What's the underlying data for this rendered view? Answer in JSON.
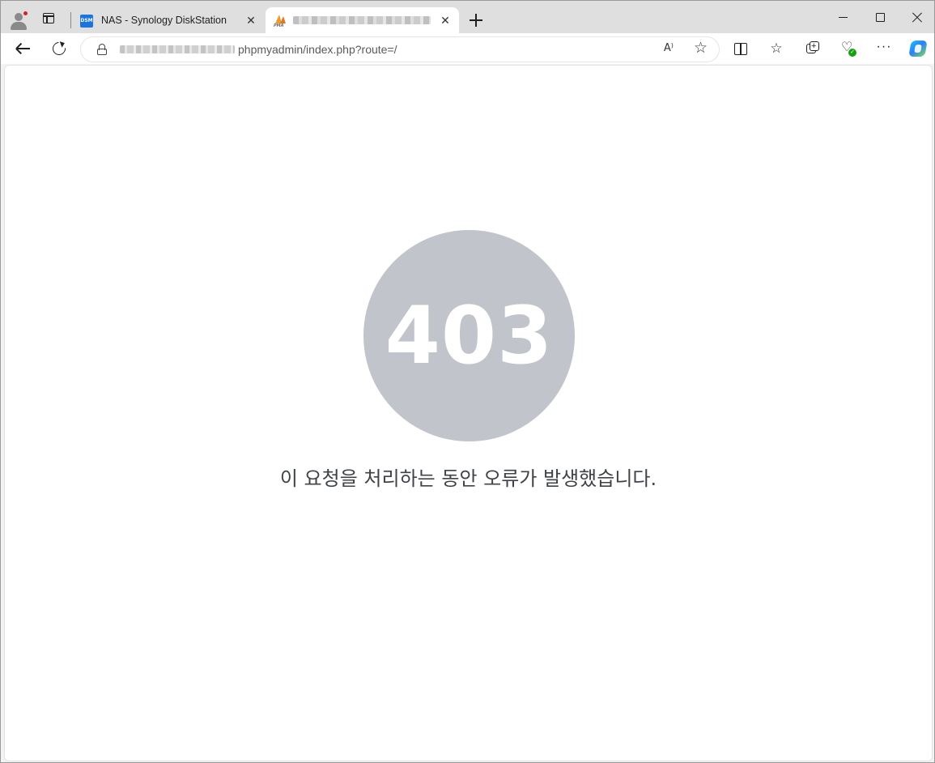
{
  "browser": {
    "tabs": [
      {
        "title": "NAS - Synology DiskStation",
        "favicon_label": "DSM",
        "active": false
      },
      {
        "title": "",
        "favicon_label": "PMA",
        "active": true,
        "title_blurred": true
      }
    ],
    "address_bar": {
      "url_visible_part": "phpmyadmin/index.php?route=/",
      "url_host_blurred": true
    },
    "read_aloud_glyph": "A⁾",
    "more_glyph": "···",
    "close_glyph": "✕",
    "icons": [
      "profile-icon",
      "tab-actions-icon",
      "new-tab-icon",
      "back-icon",
      "reload-icon",
      "lock-icon",
      "read-aloud-icon",
      "favorite-star-icon",
      "split-screen-icon",
      "favorites-icon",
      "collections-icon",
      "browser-essentials-icon",
      "more-icon",
      "copilot-icon"
    ]
  },
  "page": {
    "error_code": "403",
    "error_message": "이 요청을 처리하는 동안 오류가 발생했습니다.",
    "circle_color": "#c1c5cb",
    "text_color": "#3f4348"
  }
}
